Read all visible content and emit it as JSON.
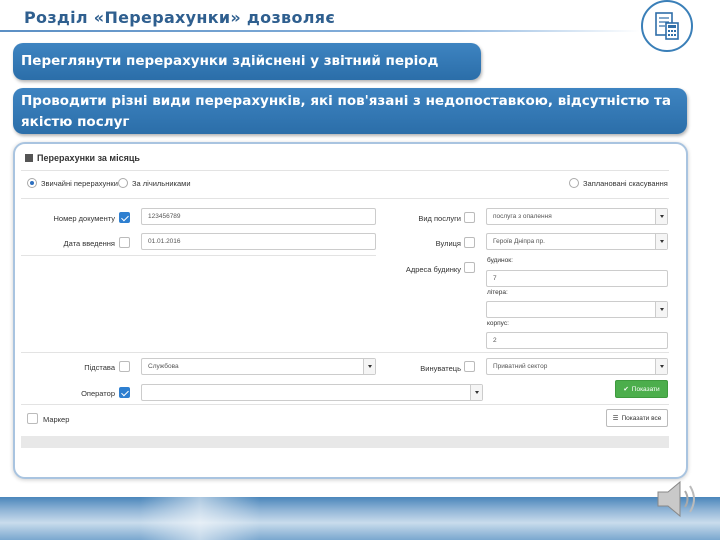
{
  "slide": {
    "title": "Розділ «Перерахунки» дозволяє",
    "banner1": "Переглянути перерахунки здійснені у звітний період",
    "banner2": "Проводити різні види перерахунків, які пов'язані з недопоставкою, відсутністю та якістю послуг"
  },
  "form": {
    "title": "Перерахунки за місяць",
    "radios": {
      "regular": "Звичайні перерахунки",
      "meters": "За лічильниками",
      "planned": "Заплановані скасування"
    },
    "fields": {
      "doc_number_label": "Номер документу",
      "doc_number_value": "123456789",
      "date_label": "Дата введення",
      "date_value": "01.01.2016",
      "service_type_label": "Вид послуги",
      "service_type_value": "послуга з опалення",
      "street_label": "Вулиця",
      "street_value": "Героїв Дніпра пр.",
      "address_label": "Адреса будинку",
      "house_label": "будинок:",
      "house_value": "7",
      "letter_label": "літера:",
      "building_label": "корпус:",
      "building_value": "2",
      "basis_label": "Підстава",
      "basis_value": "Службова",
      "culprit_label": "Винуватець",
      "culprit_value": "Приватний сектор",
      "operator_label": "Оператор",
      "marker_label": "Маркер"
    },
    "buttons": {
      "show": "Показати",
      "show_all": "Показати все"
    }
  },
  "colors": {
    "banner": "#2f76b5",
    "title": "#2f5f8f",
    "accent_check": "#2e7fd0",
    "show_button": "#4cae4c"
  }
}
